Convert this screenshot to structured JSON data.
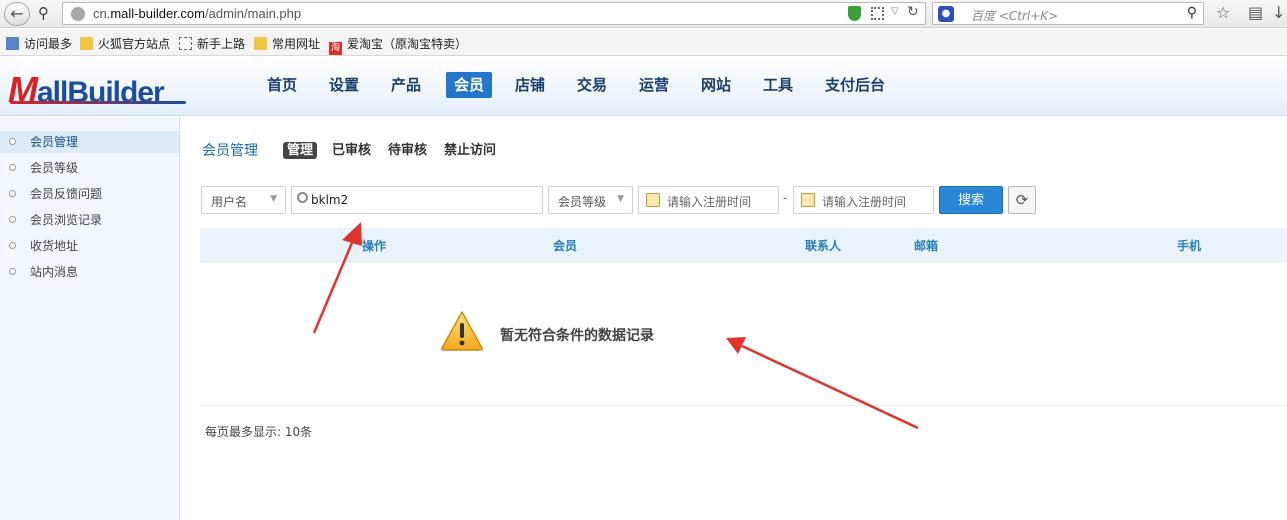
{
  "browser": {
    "url_prefix": "cn.",
    "url_domain": "mall-builder.com",
    "url_path": "/admin/main.php",
    "search_placeholder": "百度 <Ctrl+K>",
    "bookmarks": [
      "访问最多",
      "火狐官方站点",
      "新手上路",
      "常用网址",
      "爱淘宝（原淘宝特卖）"
    ],
    "icons": [
      "back-arrow-icon",
      "key-icon",
      "globe-icon",
      "shield-icon",
      "qr-code-icon",
      "reload-icon",
      "baidu-paw-icon",
      "search-icon",
      "star-icon",
      "reading-list-icon"
    ]
  },
  "header": {
    "logo_first": "M",
    "logo_rest": "allBuilder",
    "nav": [
      "首页",
      "设置",
      "产品",
      "会员",
      "店铺",
      "交易",
      "运营",
      "网站",
      "工具",
      "支付后台"
    ],
    "active_nav": "会员",
    "brand_colors": {
      "red": "#d6232a",
      "blue": "#1a4e9c",
      "accent": "#2376c9"
    }
  },
  "sidebar": {
    "items": [
      "会员管理",
      "会员等级",
      "会员反馈问题",
      "会员浏览记录",
      "收货地址",
      "站内消息"
    ],
    "active": "会员管理"
  },
  "main": {
    "section_title": "会员管理",
    "tabs": [
      "管理",
      "已审核",
      "待审核",
      "禁止访问"
    ],
    "active_tab": "管理",
    "filters": {
      "field_select": "用户名",
      "keyword_value": "bklm2",
      "level_select": "会员等级",
      "date_start_placeholder": "请输入注册时间",
      "date_separator": "-",
      "date_end_placeholder": "请输入注册时间",
      "search_button": "搜索"
    },
    "table": {
      "columns": [
        "操作",
        "会员",
        "联系人",
        "邮箱",
        "手机"
      ],
      "rows": []
    },
    "empty_message": "暂无符合条件的数据记录",
    "page_info": "每页最多显示:  10条"
  },
  "annotations": {
    "arrow_color": "#e0332e"
  }
}
